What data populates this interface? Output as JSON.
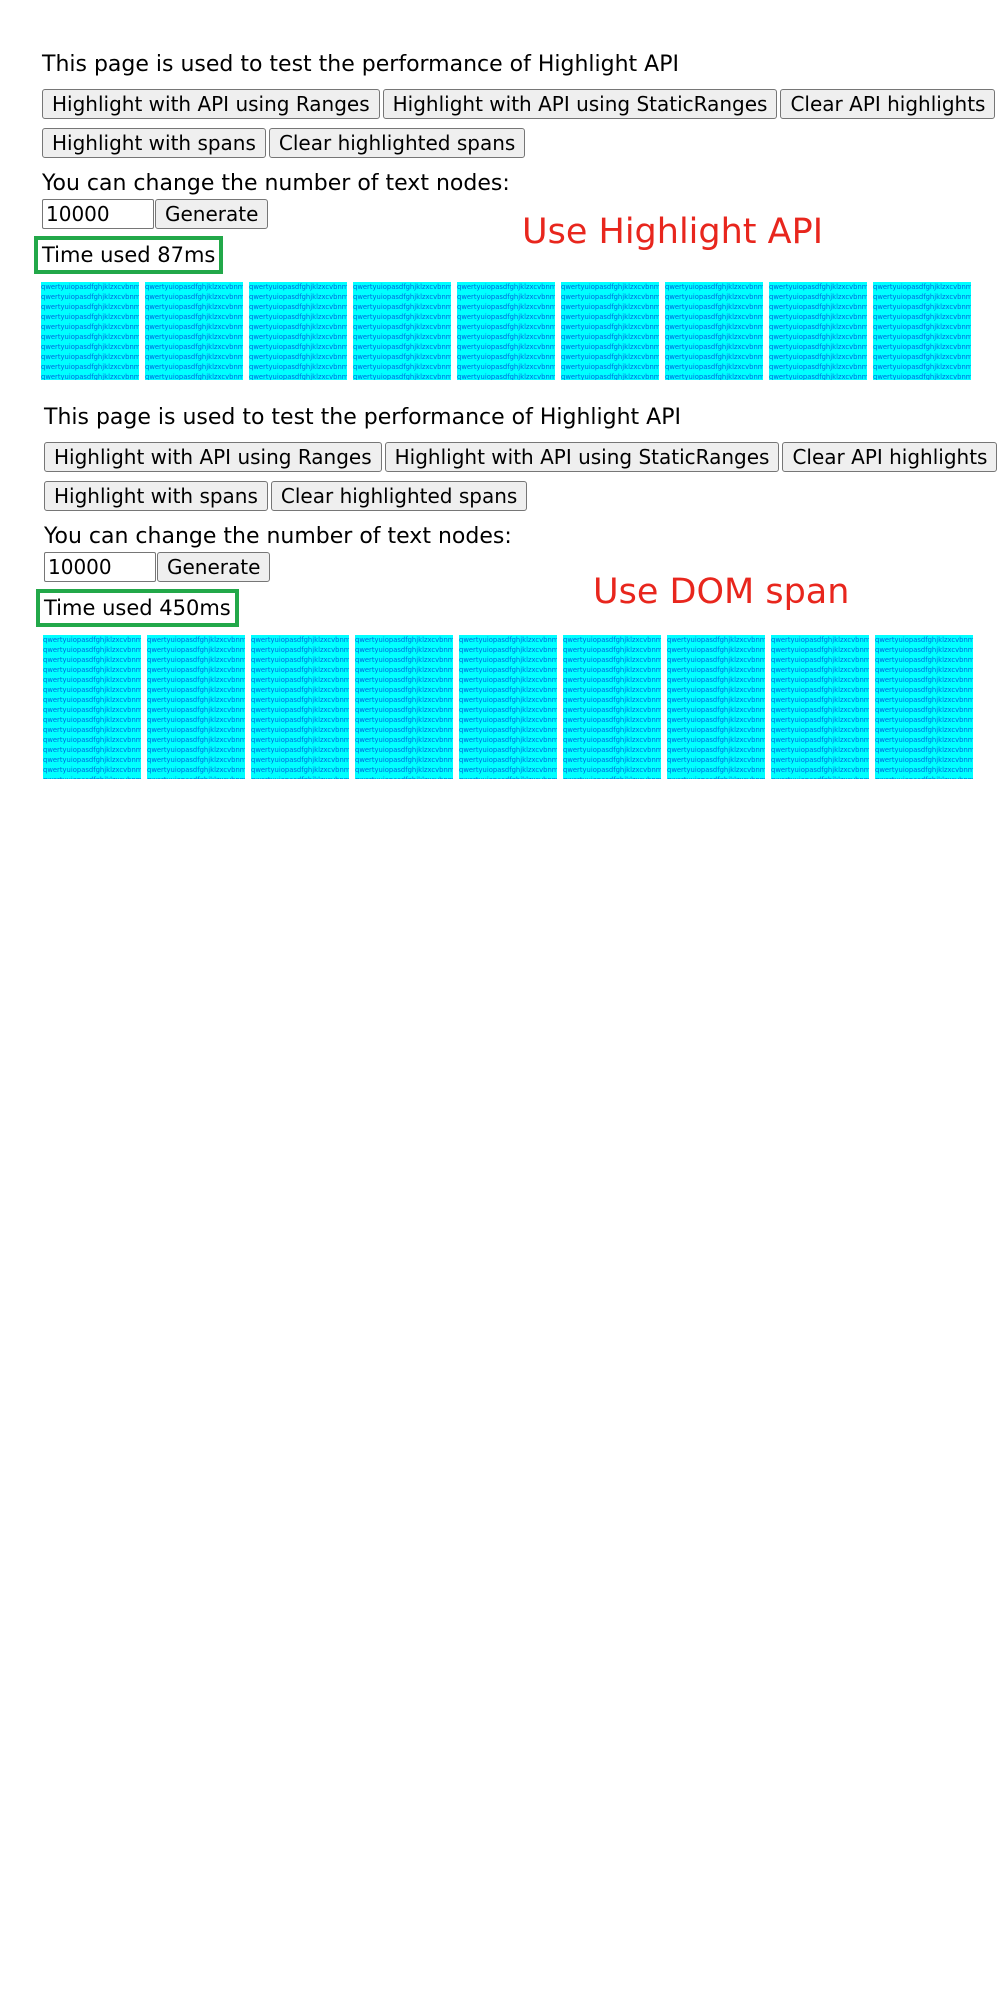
{
  "top_panel": {
    "heading": "This page is used to test the performance of Highlight API",
    "buttons": {
      "ranges": "Highlight with API using Ranges",
      "static_ranges": "Highlight with API using StaticRanges",
      "clear_api": "Clear API highlights",
      "spans": "Highlight with spans",
      "clear_spans": "Clear highlighted spans"
    },
    "node_label": "You can change the number of text nodes:",
    "node_count": "10000",
    "generate": "Generate",
    "time_used": "Time used 87ms",
    "annotation": "Use Highlight API"
  },
  "bottom_panel": {
    "heading": "This page is used to test the performance of Highlight API",
    "buttons": {
      "ranges": "Highlight with API using Ranges",
      "static_ranges": "Highlight with API using StaticRanges",
      "clear_api": "Clear API highlights",
      "spans": "Highlight with spans",
      "clear_spans": "Clear highlighted spans"
    },
    "node_label": "You can change the number of text nodes:",
    "node_count": "10000",
    "generate": "Generate",
    "time_used": "Time used 450ms",
    "annotation": "Use DOM span"
  },
  "text_node_content": "qwertyuiopasdfghjklzxcvbnm",
  "colors": {
    "highlight": "#00ffff",
    "highlight_text": "#0066dd",
    "time_border": "#22a849",
    "annotation": "#e8261d"
  }
}
